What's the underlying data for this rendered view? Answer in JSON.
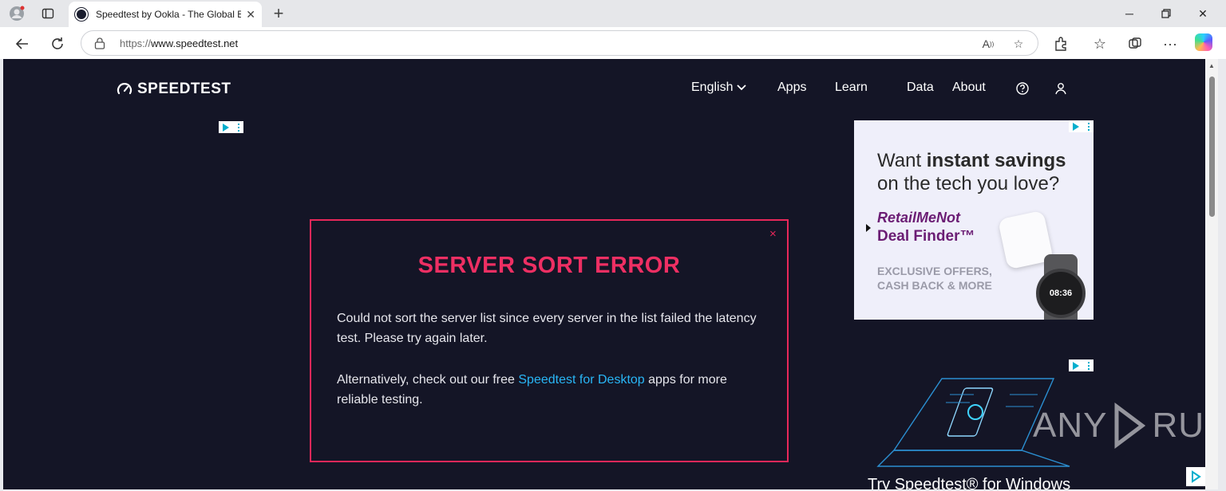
{
  "browser": {
    "tab_title": "Speedtest by Ookla - The Global B",
    "url_scheme": "https://",
    "url_host": "www.speedtest.net"
  },
  "site": {
    "logo_text": "SPEEDTEST",
    "nav": {
      "language": "English",
      "apps": "Apps",
      "learn": "Learn",
      "data": "Data",
      "about": "About"
    }
  },
  "modal": {
    "title": "SERVER SORT ERROR",
    "close_glyph": "×",
    "paragraph1": "Could not sort the server list since every server in the list failed the latency test. Please try again later.",
    "paragraph2_prefix": "Alternatively, check out our free ",
    "paragraph2_link": "Speedtest for Desktop",
    "paragraph2_suffix": " apps for more reliable testing."
  },
  "ad_top": {
    "headline_prefix": "Want ",
    "headline_bold": "instant savings",
    "headline_suffix": " on the tech you love?",
    "brand": "RetailMeNot",
    "product": "Deal Finder™",
    "sub_line1": "EXCLUSIVE OFFERS,",
    "sub_line2": "CASH BACK & MORE",
    "watch_time": "08:36"
  },
  "ad_bottom": {
    "text": "Try Speedtest® for Windows"
  },
  "watermark": {
    "left": "ANY",
    "right": "RUN"
  },
  "colors": {
    "page_bg": "#141526",
    "error_accent": "#ee2f63",
    "link": "#29b6f6"
  }
}
